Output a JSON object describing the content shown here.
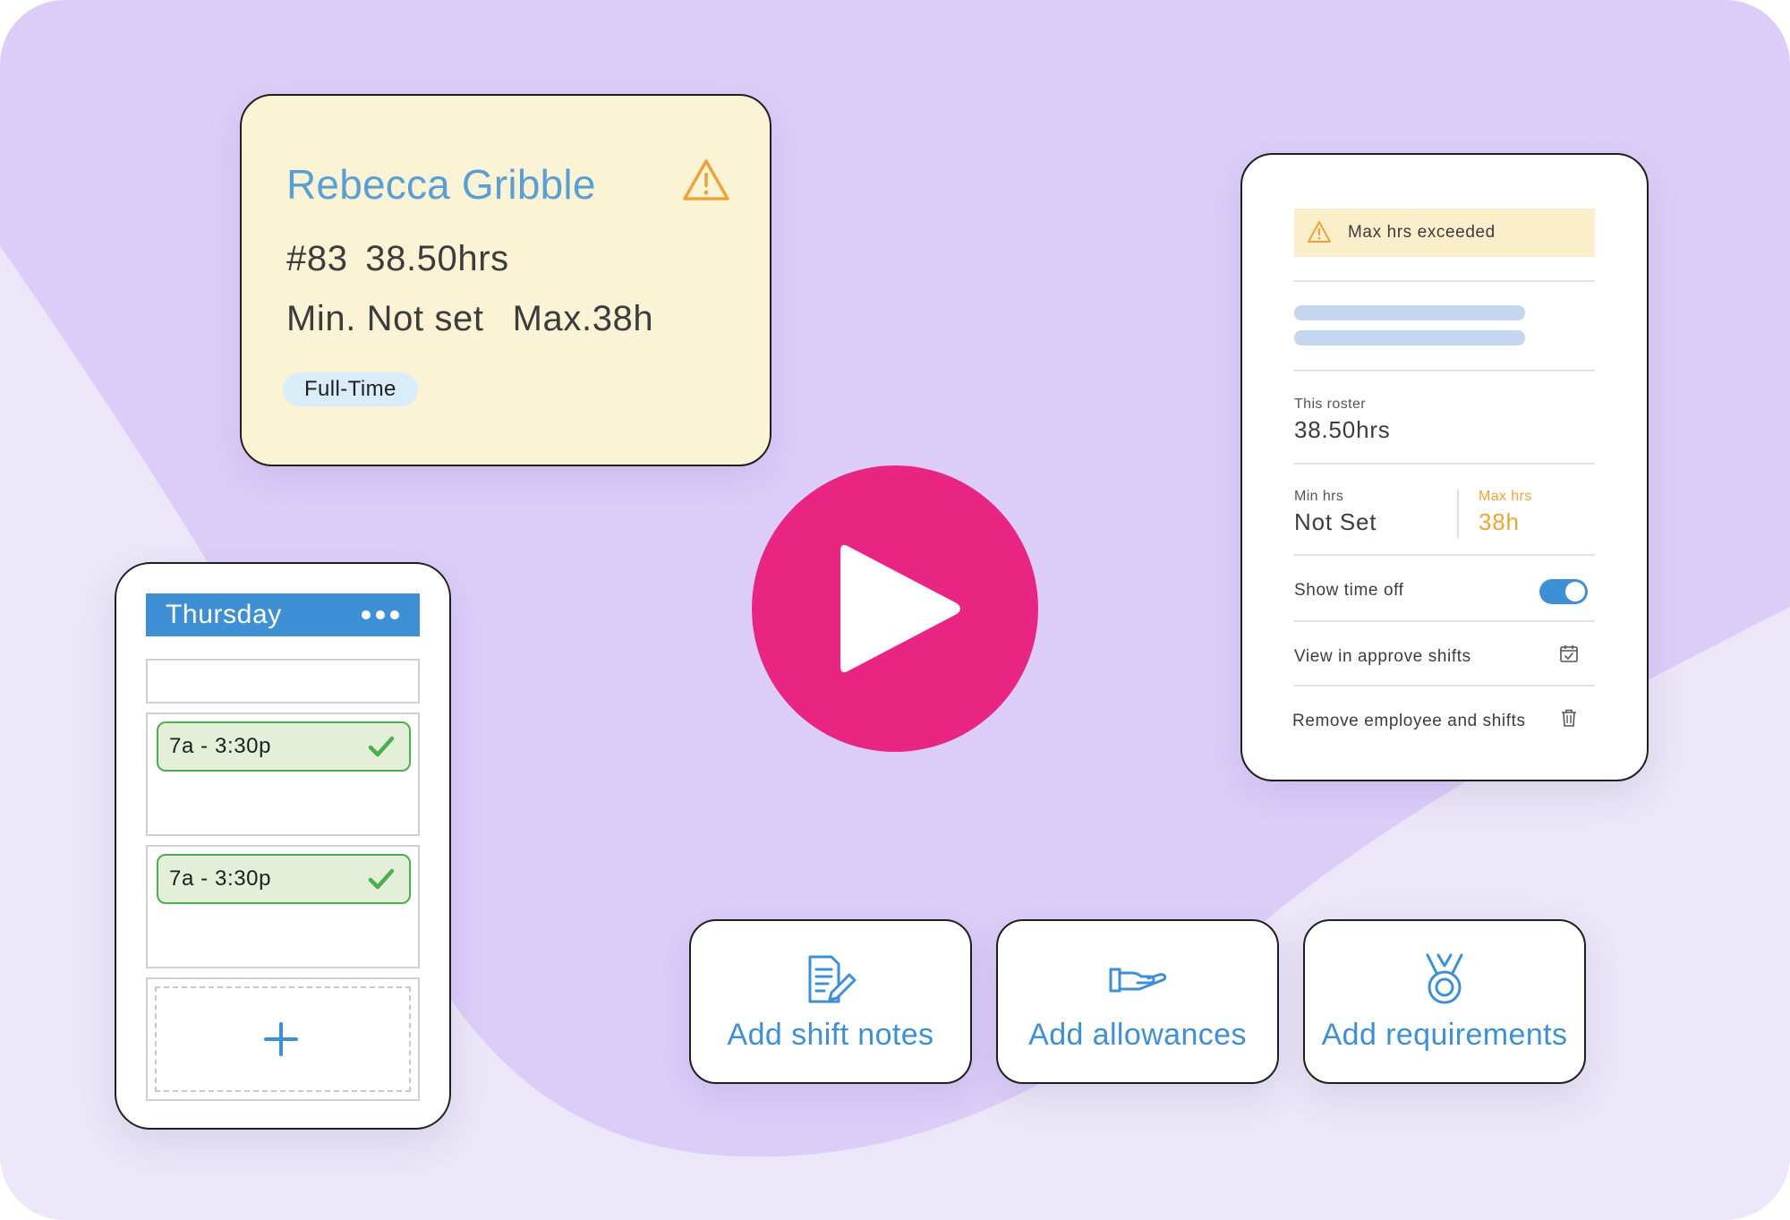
{
  "colors": {
    "background": "#ebe6f8",
    "blob": "#dccdf8",
    "accent_blue": "#3e8fd3",
    "play_pink": "#e92584",
    "warning_orange": "#eca43a",
    "success_green": "#4cae4c"
  },
  "employee_card": {
    "name": "Rebecca Gribble",
    "id_hours": "#83  38.50hrs",
    "min": "Min. Not set",
    "max": "Max.38h",
    "employment_type": "Full-Time",
    "icon": "warning-icon"
  },
  "day_column": {
    "day": "Thursday",
    "more_icon": "more-icon",
    "shifts": [
      {
        "time": "7a - 3:30p",
        "status_icon": "check-icon"
      },
      {
        "time": "7a - 3:30p",
        "status_icon": "check-icon"
      }
    ],
    "add_icon": "plus-icon"
  },
  "play_button": {
    "icon": "play-icon"
  },
  "settings_panel": {
    "alert": "Max hrs exceeded",
    "roster_label": "This roster",
    "roster_value": "38.50hrs",
    "min_label": "Min hrs",
    "min_value": "Not Set",
    "max_label": "Max hrs",
    "max_value": "38h",
    "show_time_off_label": "Show time off",
    "show_time_off_enabled": true,
    "view_approve_label": "View in approve shifts",
    "view_approve_icon": "calendar-check-icon",
    "remove_label": "Remove employee and shifts",
    "remove_icon": "trash-icon"
  },
  "actions": [
    {
      "label": "Add shift notes",
      "icon": "document-edit-icon"
    },
    {
      "label": "Add allowances",
      "icon": "hand-offer-icon"
    },
    {
      "label": "Add requirements",
      "icon": "medal-icon"
    }
  ]
}
